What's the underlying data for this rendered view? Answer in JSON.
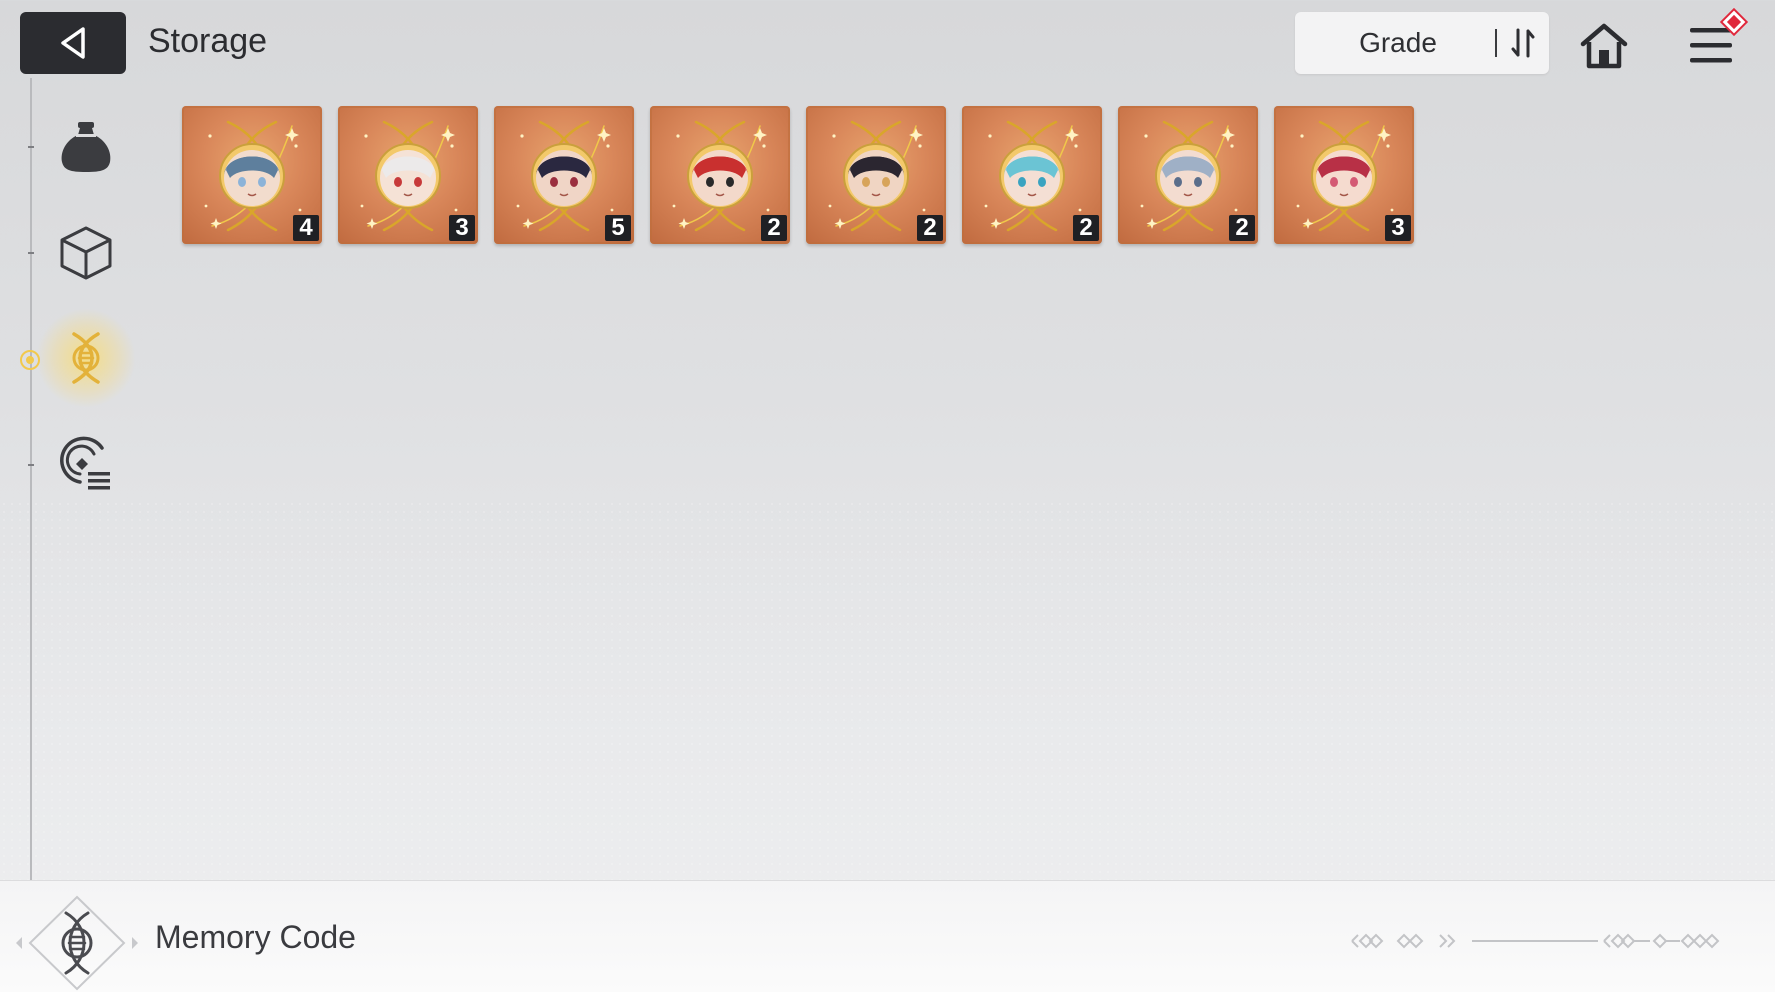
{
  "header": {
    "title": "Storage",
    "sort": {
      "label": "Grade"
    }
  },
  "sidebar": {
    "items": [
      {
        "name": "pouch",
        "icon": "pouch-icon",
        "active": false
      },
      {
        "name": "cube",
        "icon": "cube-icon",
        "active": false
      },
      {
        "name": "memory-code",
        "icon": "dna-icon",
        "active": true
      },
      {
        "name": "disc-list",
        "icon": "disc-list-icon",
        "active": false
      }
    ]
  },
  "items": [
    {
      "count": "4",
      "hair": "#5e7f9d",
      "skin": "#f2dccd",
      "accent": "#8cb3d8"
    },
    {
      "count": "3",
      "hair": "#eceaea",
      "skin": "#f5e2d6",
      "accent": "#c73a3a"
    },
    {
      "count": "5",
      "hair": "#2a2840",
      "skin": "#f0d5c6",
      "accent": "#9b2f3f"
    },
    {
      "count": "2",
      "hair": "#c9302f",
      "skin": "#f3d9ca",
      "accent": "#2a2a2a"
    },
    {
      "count": "2",
      "hair": "#2b2630",
      "skin": "#f0d5c3",
      "accent": "#d7a45a"
    },
    {
      "count": "2",
      "hair": "#6bc4d4",
      "skin": "#f4dfd4",
      "accent": "#3aa3c0"
    },
    {
      "count": "2",
      "hair": "#9fb0c6",
      "skin": "#f3dcd0",
      "accent": "#5b6e8b"
    },
    {
      "count": "3",
      "hair": "#b83046",
      "skin": "#f5dbcf",
      "accent": "#d45a74"
    }
  ],
  "footer": {
    "label": "Memory Code",
    "icon": "dna-icon"
  },
  "colors": {
    "accent_gold": "#f2c94c",
    "card_bg": "#d9875a",
    "dark": "#2b2c30",
    "notification": "#e0283c"
  }
}
